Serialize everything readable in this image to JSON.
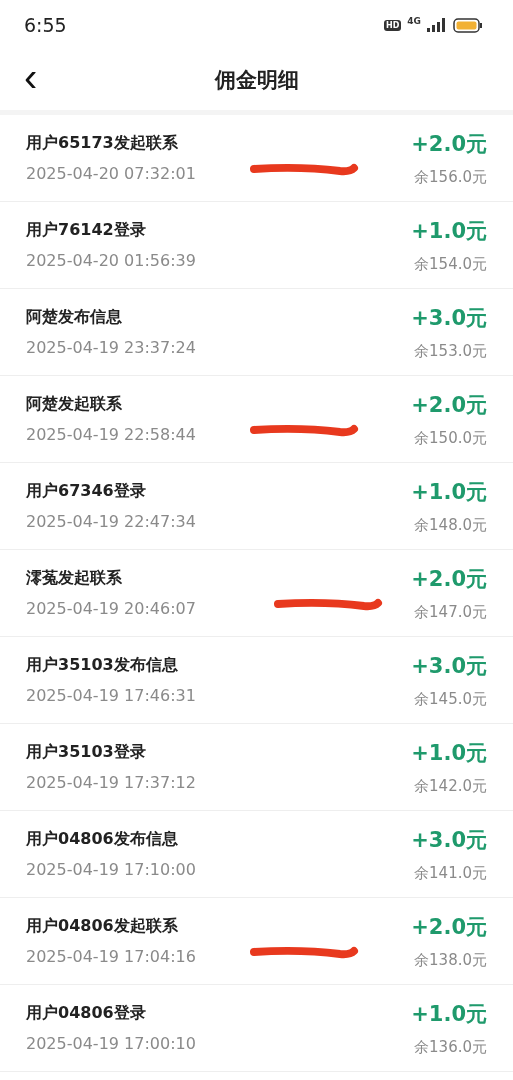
{
  "status_bar": {
    "time": "6:55",
    "hd_badge": "HD",
    "network": "4G"
  },
  "nav": {
    "back_icon": "‹",
    "title": "佣金明细"
  },
  "records": [
    {
      "title": "用户65173发起联系",
      "time": "2025-04-20 07:32:01",
      "amount": "+2.0元",
      "balance": "余156.0元",
      "marked": true
    },
    {
      "title": "用户76142登录",
      "time": "2025-04-20 01:56:39",
      "amount": "+1.0元",
      "balance": "余154.0元",
      "marked": false
    },
    {
      "title": "阿楚发布信息",
      "time": "2025-04-19 23:37:24",
      "amount": "+3.0元",
      "balance": "余153.0元",
      "marked": false
    },
    {
      "title": "阿楚发起联系",
      "time": "2025-04-19 22:58:44",
      "amount": "+2.0元",
      "balance": "余150.0元",
      "marked": true
    },
    {
      "title": "用户67346登录",
      "time": "2025-04-19 22:47:34",
      "amount": "+1.0元",
      "balance": "余148.0元",
      "marked": false
    },
    {
      "title": "澪菟发起联系",
      "time": "2025-04-19 20:46:07",
      "amount": "+2.0元",
      "balance": "余147.0元",
      "marked": true
    },
    {
      "title": "用户35103发布信息",
      "time": "2025-04-19 17:46:31",
      "amount": "+3.0元",
      "balance": "余145.0元",
      "marked": false
    },
    {
      "title": "用户35103登录",
      "time": "2025-04-19 17:37:12",
      "amount": "+1.0元",
      "balance": "余142.0元",
      "marked": false
    },
    {
      "title": "用户04806发布信息",
      "time": "2025-04-19 17:10:00",
      "amount": "+3.0元",
      "balance": "余141.0元",
      "marked": false
    },
    {
      "title": "用户04806发起联系",
      "time": "2025-04-19 17:04:16",
      "amount": "+2.0元",
      "balance": "余138.0元",
      "marked": true
    },
    {
      "title": "用户04806登录",
      "time": "2025-04-19 17:00:10",
      "amount": "+1.0元",
      "balance": "余136.0元",
      "marked": false
    }
  ]
}
